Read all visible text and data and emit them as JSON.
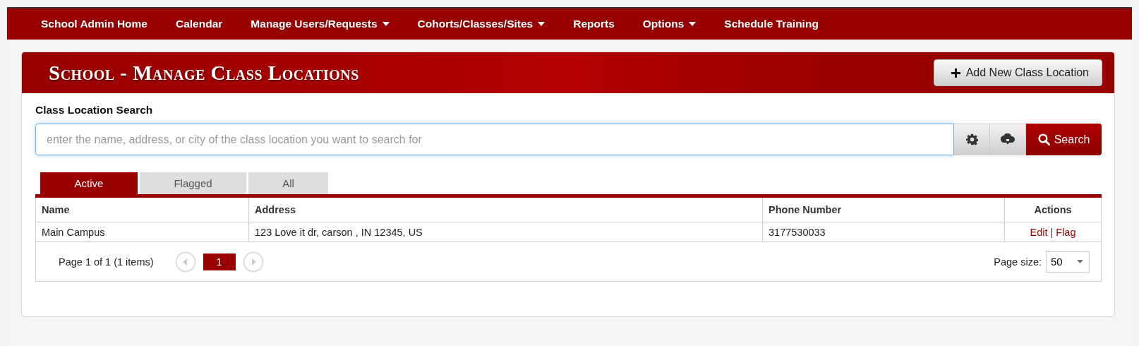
{
  "nav": {
    "items": [
      {
        "label": "School Admin Home",
        "dropdown": false
      },
      {
        "label": "Calendar",
        "dropdown": false
      },
      {
        "label": "Manage Users/Requests",
        "dropdown": true
      },
      {
        "label": "Cohorts/Classes/Sites",
        "dropdown": true
      },
      {
        "label": "Reports",
        "dropdown": false
      },
      {
        "label": "Options",
        "dropdown": true
      },
      {
        "label": "Schedule Training",
        "dropdown": false
      }
    ]
  },
  "page": {
    "title": "School - Manage Class Locations",
    "add_button": "Add New Class Location"
  },
  "search": {
    "label": "Class Location Search",
    "placeholder": "enter the name, address, or city of the class location you want to search for",
    "button": "Search"
  },
  "tabs": [
    {
      "label": "Active",
      "selected": true
    },
    {
      "label": "Flagged",
      "selected": false
    },
    {
      "label": "All",
      "selected": false
    }
  ],
  "table": {
    "columns": [
      "Name",
      "Address",
      "Phone Number",
      "Actions"
    ],
    "rows": [
      {
        "cells": [
          "Main Campus",
          "123 Love it dr, carson , IN 12345, US",
          "3177530033"
        ],
        "actions": [
          "Edit",
          "Flag"
        ],
        "separator": "|"
      }
    ]
  },
  "pager": {
    "summary": "Page 1 of 1 (1 items)",
    "pages": [
      {
        "label": "1",
        "selected": true
      }
    ],
    "page_size_label": "Page size:",
    "page_size": "50"
  }
}
